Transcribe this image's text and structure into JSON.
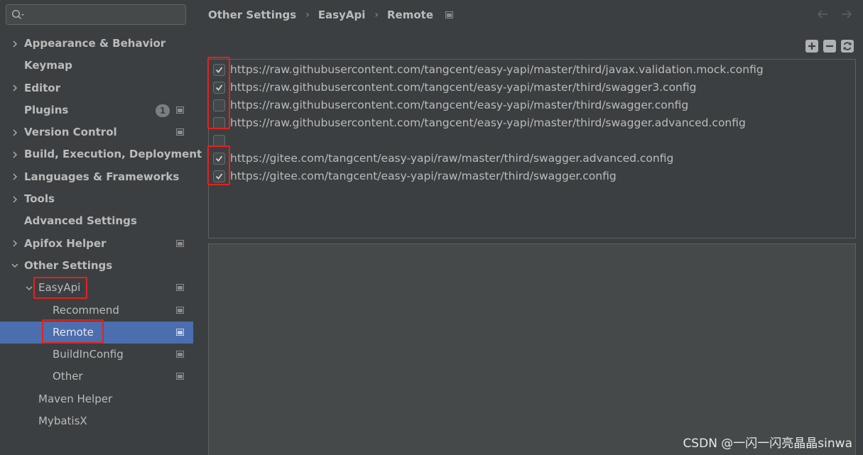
{
  "search": {
    "placeholder": ""
  },
  "sidebar": {
    "items": [
      {
        "label": "Appearance & Behavior"
      },
      {
        "label": "Keymap"
      },
      {
        "label": "Editor"
      },
      {
        "label": "Plugins",
        "badge": "1"
      },
      {
        "label": "Version Control"
      },
      {
        "label": "Build, Execution, Deployment"
      },
      {
        "label": "Languages & Frameworks"
      },
      {
        "label": "Tools"
      },
      {
        "label": "Advanced Settings"
      },
      {
        "label": "Apifox Helper"
      },
      {
        "label": "Other Settings"
      },
      {
        "label": "EasyApi"
      },
      {
        "label": "Recommend"
      },
      {
        "label": "Remote"
      },
      {
        "label": "BuildInConfig"
      },
      {
        "label": "Other"
      },
      {
        "label": "Maven Helper"
      },
      {
        "label": "MybatisX"
      }
    ]
  },
  "breadcrumb": {
    "parts": [
      "Other Settings",
      "EasyApi",
      "Remote"
    ],
    "separator": "›"
  },
  "remote_list": {
    "rows": [
      {
        "url": "https://raw.githubusercontent.com/tangcent/easy-yapi/master/third/javax.validation.mock.config",
        "checked": true
      },
      {
        "url": "https://raw.githubusercontent.com/tangcent/easy-yapi/master/third/swagger3.config",
        "checked": true
      },
      {
        "url": "https://raw.githubusercontent.com/tangcent/easy-yapi/master/third/swagger.config",
        "checked": false
      },
      {
        "url": "https://raw.githubusercontent.com/tangcent/easy-yapi/master/third/swagger.advanced.config",
        "checked": false
      },
      {
        "url": "",
        "checked": false
      },
      {
        "url": "https://gitee.com/tangcent/easy-yapi/raw/master/third/swagger.advanced.config",
        "checked": true
      },
      {
        "url": "https://gitee.com/tangcent/easy-yapi/raw/master/third/swagger.config",
        "checked": true
      }
    ]
  },
  "colors": {
    "background": "#3c3f41",
    "selection": "#4b6eaf",
    "highlight": "#e3231c",
    "text": "#bbbbbb"
  },
  "watermark": "CSDN @一闪一闪亮晶晶sinwa"
}
